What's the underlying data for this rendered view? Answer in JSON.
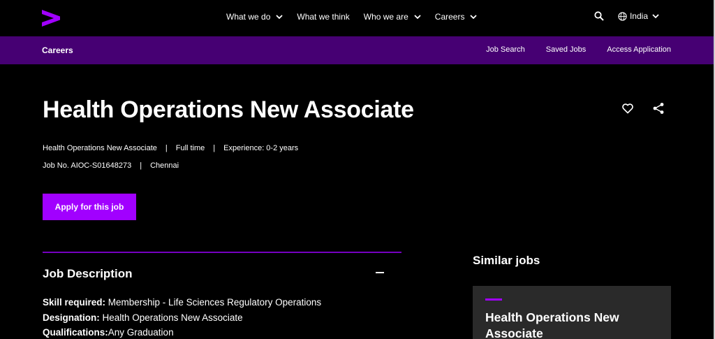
{
  "header": {
    "nav": [
      {
        "label": "What we do",
        "dropdown": true
      },
      {
        "label": "What we think",
        "dropdown": false
      },
      {
        "label": "Who we are",
        "dropdown": true
      },
      {
        "label": "Careers",
        "dropdown": true
      }
    ],
    "locale": "India",
    "icons": {
      "logo": "accenture-chevron-logo",
      "search": "search-icon",
      "locale": "globe-icon"
    }
  },
  "subnav": {
    "title": "Careers",
    "links": [
      "Job Search",
      "Saved Jobs",
      "Access Application"
    ]
  },
  "job": {
    "title": "Health Operations New Associate",
    "meta_line1": [
      "Health Operations New Associate",
      "Full time",
      "Experience: 0-2 years"
    ],
    "meta_line2": [
      "Job No. AIOC-S01648273",
      "Chennai"
    ],
    "apply_label": "Apply for this job"
  },
  "description": {
    "title": "Job Description",
    "lines": [
      {
        "label": "Skill required:",
        "value": " Membership - Life Sciences Regulatory Operations"
      },
      {
        "label": "Designation:",
        "value": " Health Operations New Associate"
      },
      {
        "label": "Qualifications:",
        "value": "Any Graduation"
      }
    ]
  },
  "similar": {
    "title": "Similar jobs",
    "cards": [
      {
        "title": "Health Operations New Associate"
      }
    ]
  },
  "colors": {
    "accent": "#a100ff",
    "subnav_bg": "#460073",
    "rule": "#7500c0",
    "card_bg": "#2a2a2a"
  }
}
